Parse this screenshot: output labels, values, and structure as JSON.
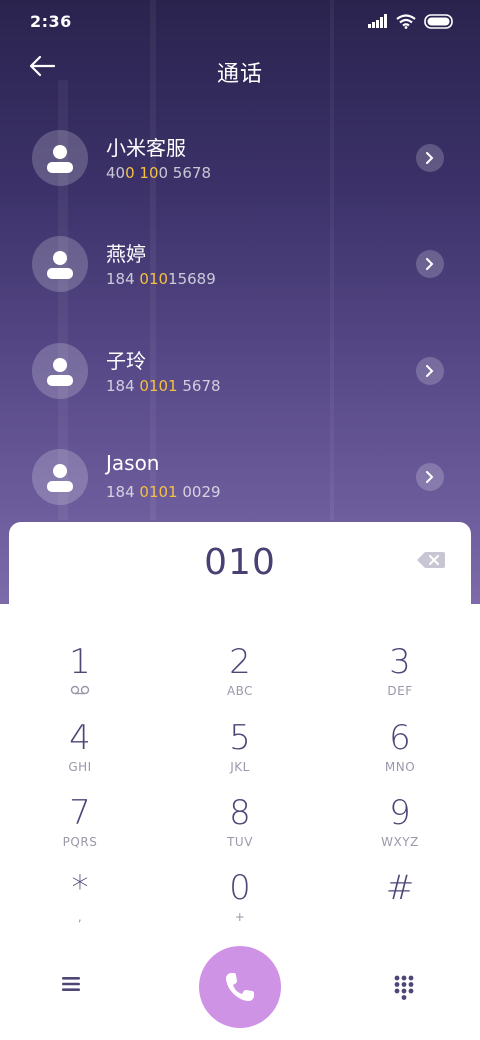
{
  "status_bar": {
    "time": "2:36",
    "icons": [
      "signal-icon",
      "wifi-icon",
      "battery-icon"
    ]
  },
  "header": {
    "title": "通话",
    "back_icon": "back-arrow-icon"
  },
  "contacts": [
    {
      "name": "小米客服",
      "number_parts": [
        "40",
        "0 10",
        "0 5678"
      ]
    },
    {
      "name": "燕婷",
      "number_parts": [
        "184 ",
        "010",
        "15689"
      ]
    },
    {
      "name": "子玲",
      "number_parts": [
        "184 ",
        "0101",
        " 5678"
      ]
    },
    {
      "name": "Jason",
      "number_parts": [
        "184 ",
        "0101",
        " 0029"
      ]
    }
  ],
  "dialer": {
    "input_value": "010",
    "keys": [
      {
        "digit": "1",
        "letters": "",
        "icon": "voicemail-icon"
      },
      {
        "digit": "2",
        "letters": "ABC"
      },
      {
        "digit": "3",
        "letters": "DEF"
      },
      {
        "digit": "4",
        "letters": "GHI"
      },
      {
        "digit": "5",
        "letters": "JKL"
      },
      {
        "digit": "6",
        "letters": "MNO"
      },
      {
        "digit": "7",
        "letters": "PQRS"
      },
      {
        "digit": "8",
        "letters": "TUV"
      },
      {
        "digit": "9",
        "letters": "WXYZ"
      },
      {
        "digit": "*",
        "letters": ","
      },
      {
        "digit": "0",
        "letters": "+"
      },
      {
        "digit": "#",
        "letters": ""
      }
    ]
  },
  "bottom_bar": {
    "menu_icon": "menu-icon",
    "call_icon": "phone-icon",
    "keypad_icon": "keypad-grid-icon"
  },
  "colors": {
    "highlight": "#f5c042",
    "call_button": "#cf93e6",
    "digit_text": "#4e4677"
  }
}
